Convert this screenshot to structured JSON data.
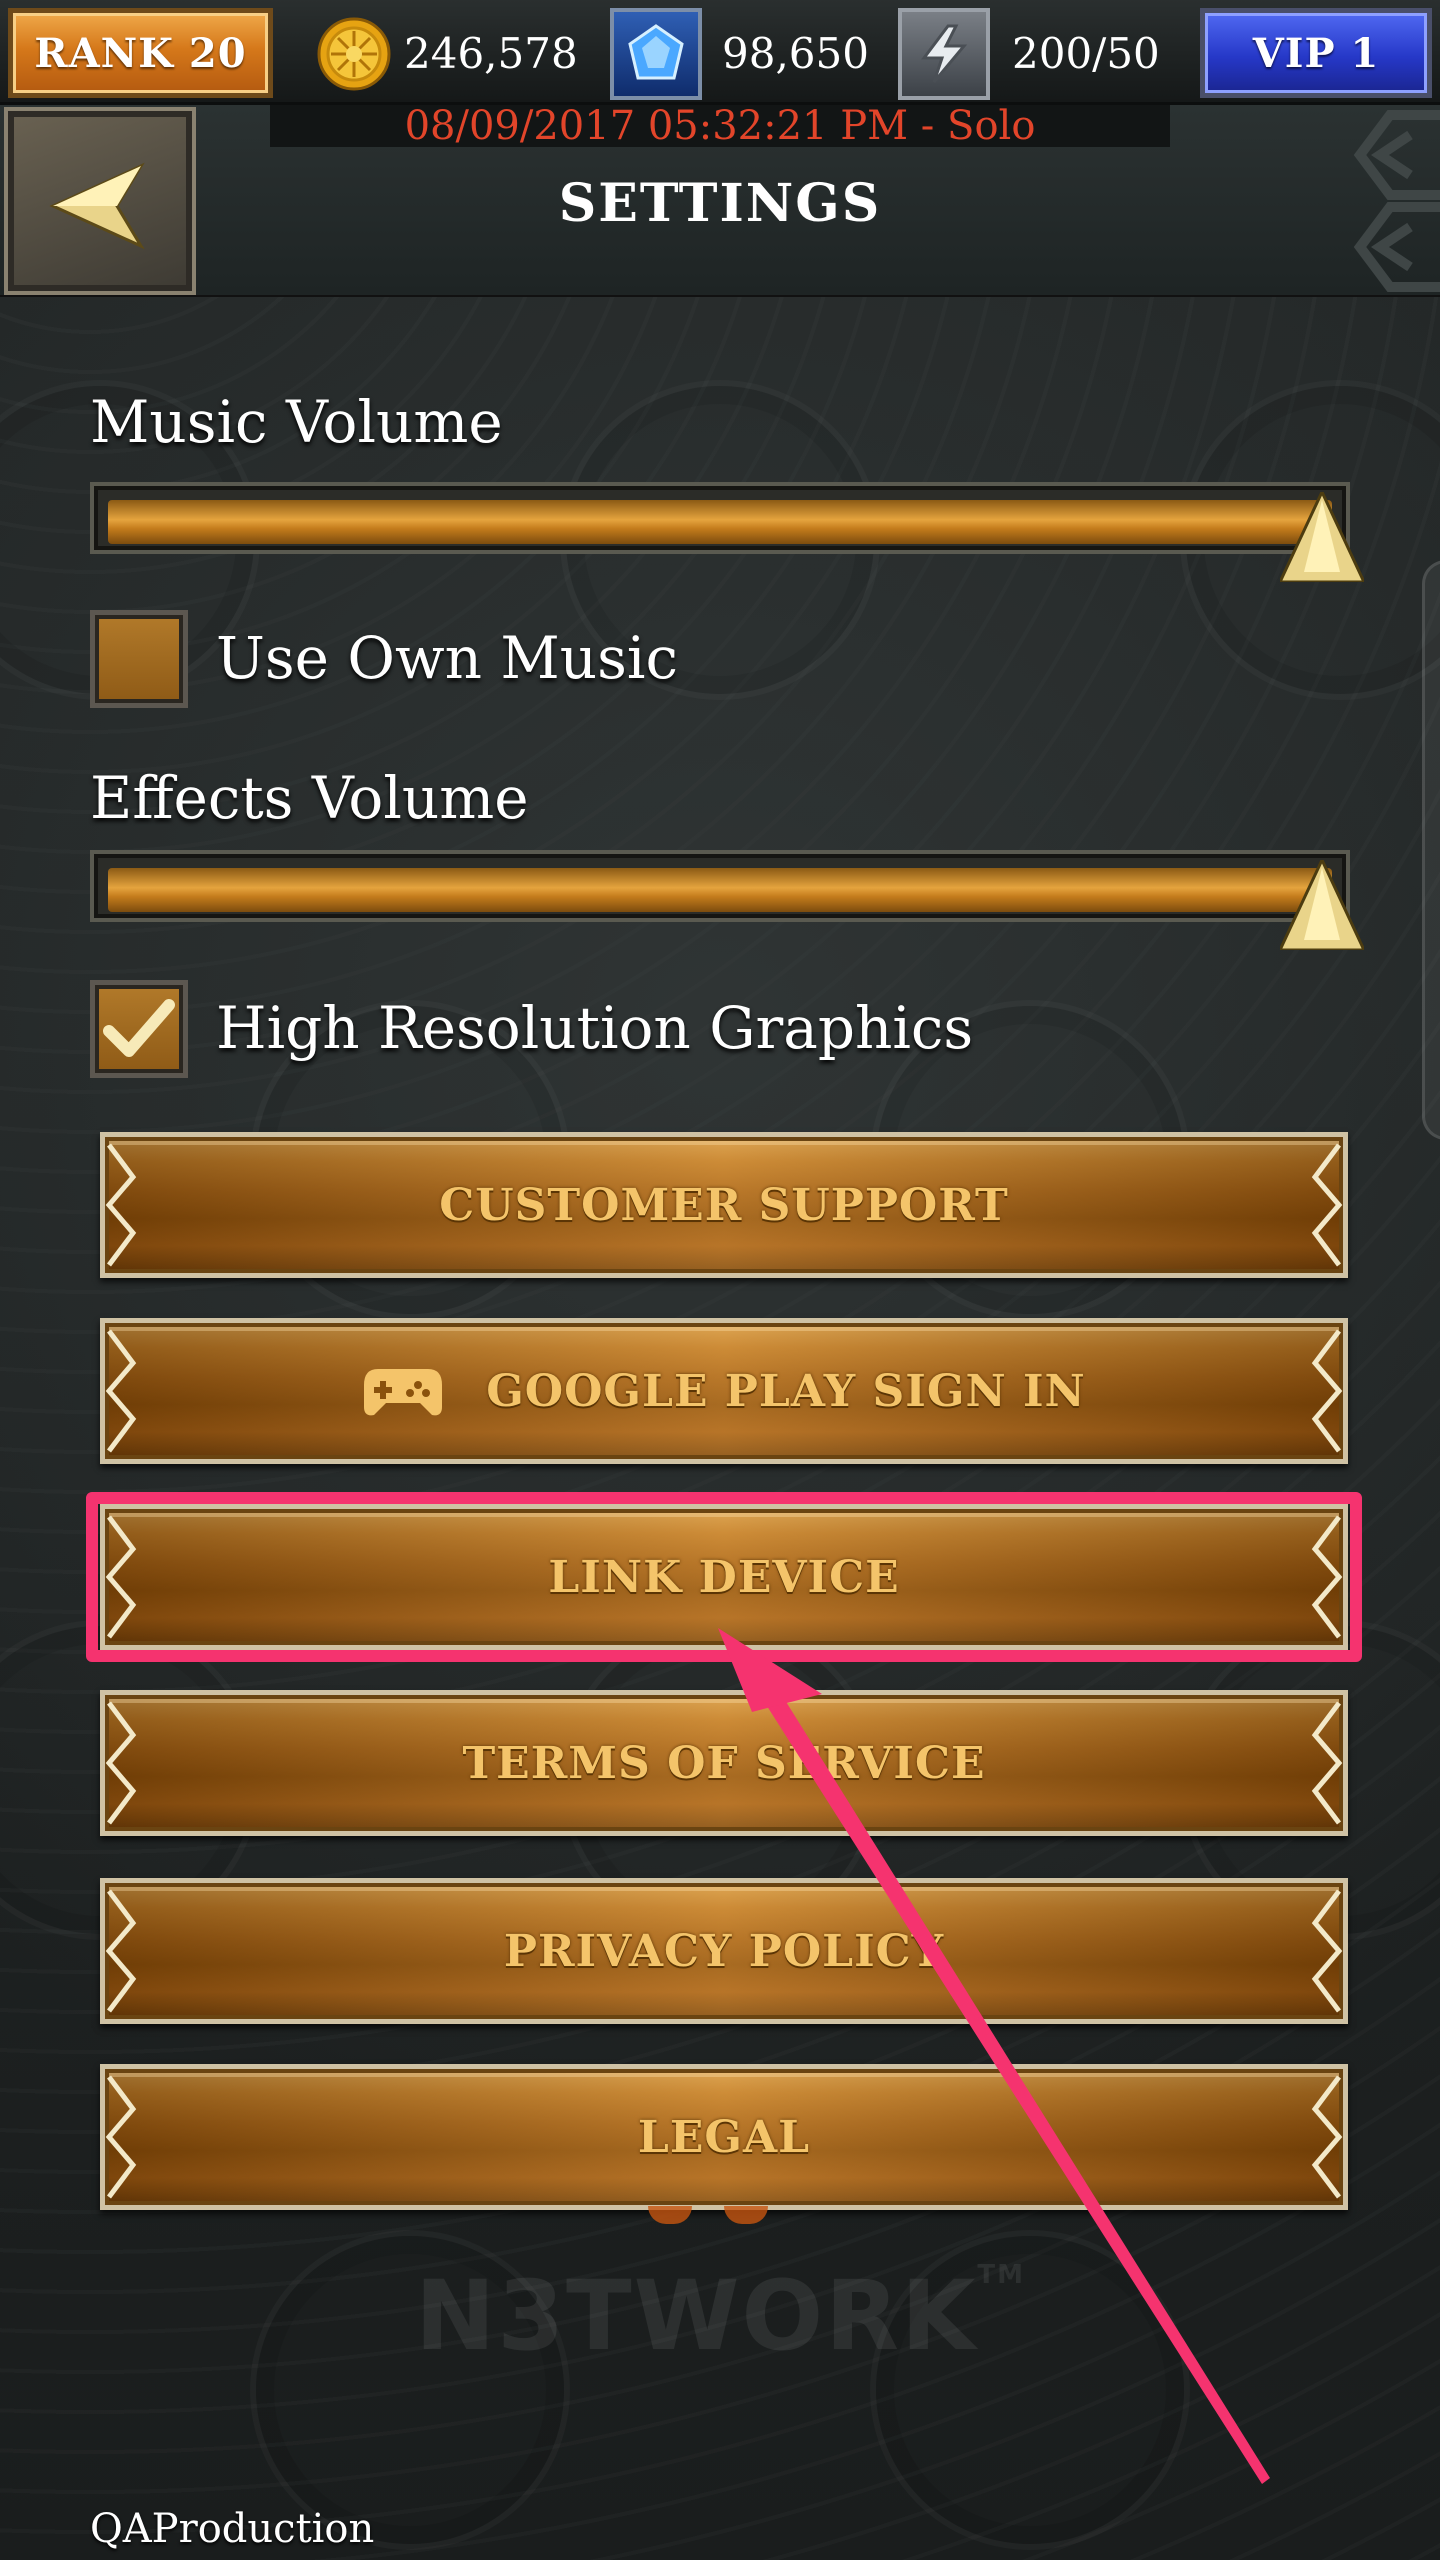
{
  "status_bar": {
    "rank": "RANK 20",
    "gold": "246,578",
    "gems": "98,650",
    "energy": "200/50",
    "vip": "VIP 1"
  },
  "header": {
    "timestamp": "08/09/2017 05:32:21 PM - Solo",
    "title": "SETTINGS"
  },
  "settings": {
    "music_volume_label": "Music Volume",
    "music_volume_level": 1.0,
    "use_own_music_label": "Use Own Music",
    "use_own_music_checked": false,
    "effects_volume_label": "Effects Volume",
    "effects_volume_level": 1.0,
    "high_res_label": "High Resolution Graphics",
    "high_res_checked": true
  },
  "buttons": {
    "customer_support": "CUSTOMER SUPPORT",
    "google_play": "GOOGLE PLAY SIGN IN",
    "link_device": "LINK DEVICE",
    "terms": "TERMS OF SERVICE",
    "privacy": "PRIVACY POLICY",
    "legal": "LEGAL"
  },
  "footer": {
    "brand": "N3TWORK",
    "brand_tm": "TM",
    "build": "QAProduction"
  },
  "colors": {
    "highlight": "#f5336f",
    "timestamp": "#e2452a",
    "button_text": "#f4c46a"
  },
  "icons": {
    "rank": "rank-badge",
    "gold": "gold-coin-icon",
    "gems": "blue-gem-icon",
    "energy": "lightning-icon",
    "back": "back-arrow-icon",
    "google_play": "gamepad-icon"
  }
}
